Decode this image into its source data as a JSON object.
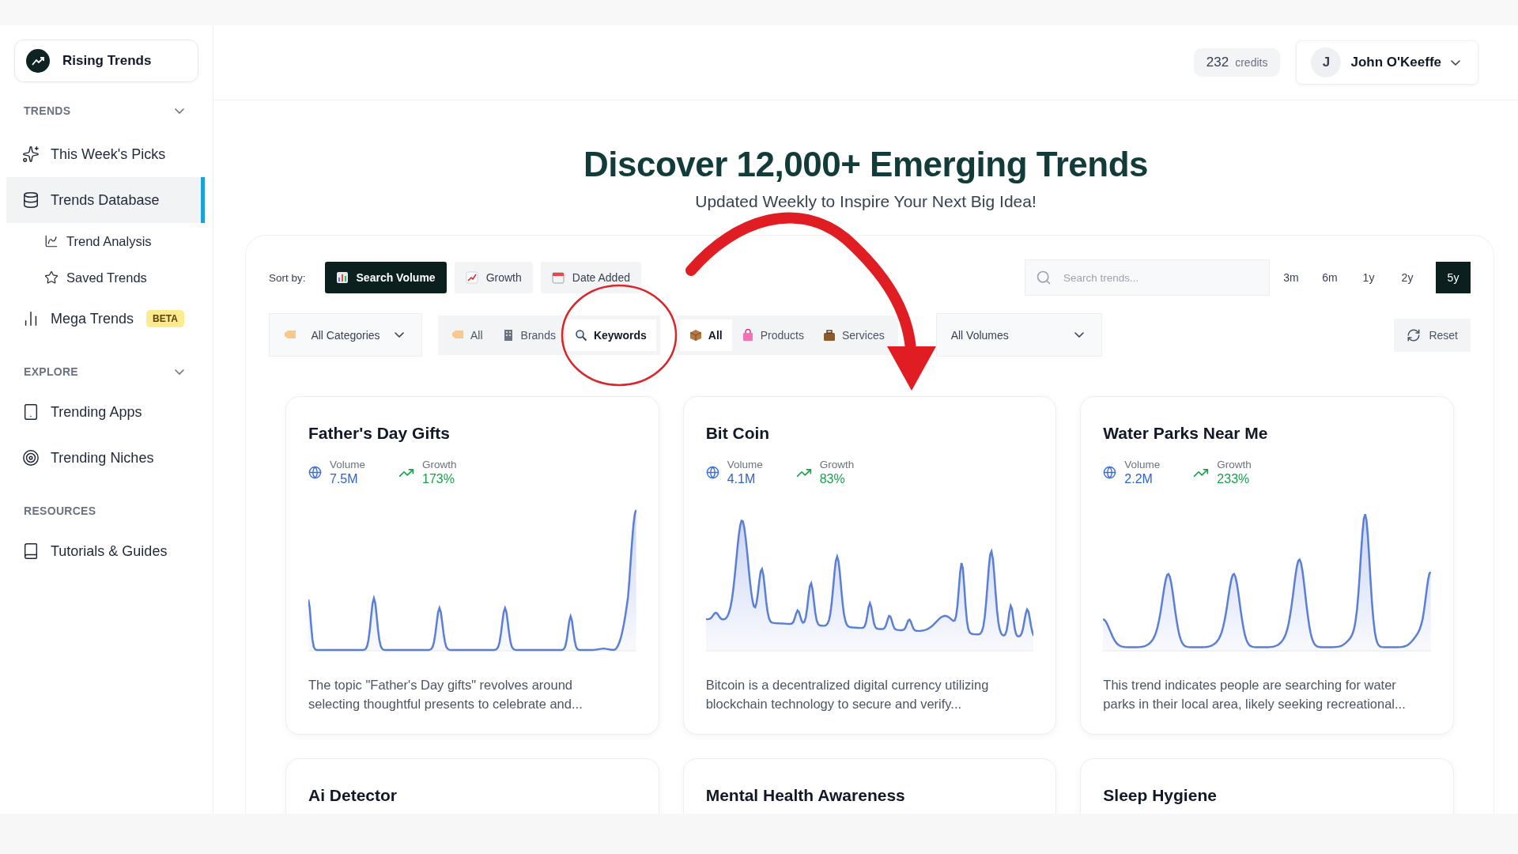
{
  "brand": {
    "name": "Rising Trends"
  },
  "sidebar": {
    "sections": [
      {
        "title": "TRENDS",
        "expanded": true,
        "items": [
          {
            "label": "This Week's Picks",
            "selected": false
          },
          {
            "label": "Trends Database",
            "selected": true,
            "children": [
              {
                "label": "Trend Analysis",
                "selected": false
              },
              {
                "label": "Saved Trends",
                "selected": false
              }
            ]
          },
          {
            "label": "Mega Trends",
            "selected": false,
            "badge": "BETA"
          }
        ]
      },
      {
        "title": "EXPLORE",
        "expanded": true,
        "items": [
          {
            "label": "Trending Apps",
            "selected": false
          },
          {
            "label": "Trending Niches",
            "selected": false
          }
        ]
      },
      {
        "title": "RESOURCES",
        "items": [
          {
            "label": "Tutorials & Guides",
            "selected": false
          }
        ]
      }
    ]
  },
  "header": {
    "credits": {
      "value": "232",
      "label": "credits"
    },
    "user": {
      "initial": "J",
      "name": "John O'Keeffe"
    }
  },
  "hero": {
    "title": "Discover 12,000+ Emerging Trends",
    "subtitle": "Updated Weekly to Inspire Your Next Big Idea!"
  },
  "sort": {
    "label": "Sort by:",
    "options": [
      {
        "label": "Search Volume",
        "selected": true
      },
      {
        "label": "Growth",
        "selected": false
      },
      {
        "label": "Date Added",
        "selected": false
      }
    ],
    "search": {
      "placeholder": "Search trends..."
    },
    "ranges": [
      {
        "label": "3m",
        "selected": false
      },
      {
        "label": "6m",
        "selected": false
      },
      {
        "label": "1y",
        "selected": false
      },
      {
        "label": "2y",
        "selected": false
      },
      {
        "label": "5y",
        "selected": true
      }
    ]
  },
  "filters": {
    "category": "All Categories",
    "types": [
      {
        "label": "All",
        "selected": false
      },
      {
        "label": "Brands",
        "selected": false
      },
      {
        "label": "Keywords",
        "selected": true
      }
    ],
    "kinds": [
      {
        "label": "All",
        "selected": true
      },
      {
        "label": "Products",
        "selected": false
      },
      {
        "label": "Services",
        "selected": false
      }
    ],
    "volume": "All Volumes",
    "reset": "Reset"
  },
  "cards": [
    {
      "title": "Father's Day Gifts",
      "volume_label": "Volume",
      "volume": "7.5M",
      "growth_label": "Growth",
      "growth": "173%",
      "description": "The topic \"Father's Day gifts\" revolves around selecting thoughtful presents to celebrate and..."
    },
    {
      "title": "Bit Coin",
      "volume_label": "Volume",
      "volume": "4.1M",
      "growth_label": "Growth",
      "growth": "83%",
      "description": "Bitcoin is a decentralized digital currency utilizing blockchain technology to secure and verify..."
    },
    {
      "title": "Water Parks Near Me",
      "volume_label": "Volume",
      "volume": "2.2M",
      "growth_label": "Growth",
      "growth": "233%",
      "description": "This trend indicates people are searching for water parks in their local area, likely seeking recreational..."
    },
    {
      "title": "Ai Detector"
    },
    {
      "title": "Mental Health Awareness"
    },
    {
      "title": "Sleep Hygiene"
    }
  ]
}
